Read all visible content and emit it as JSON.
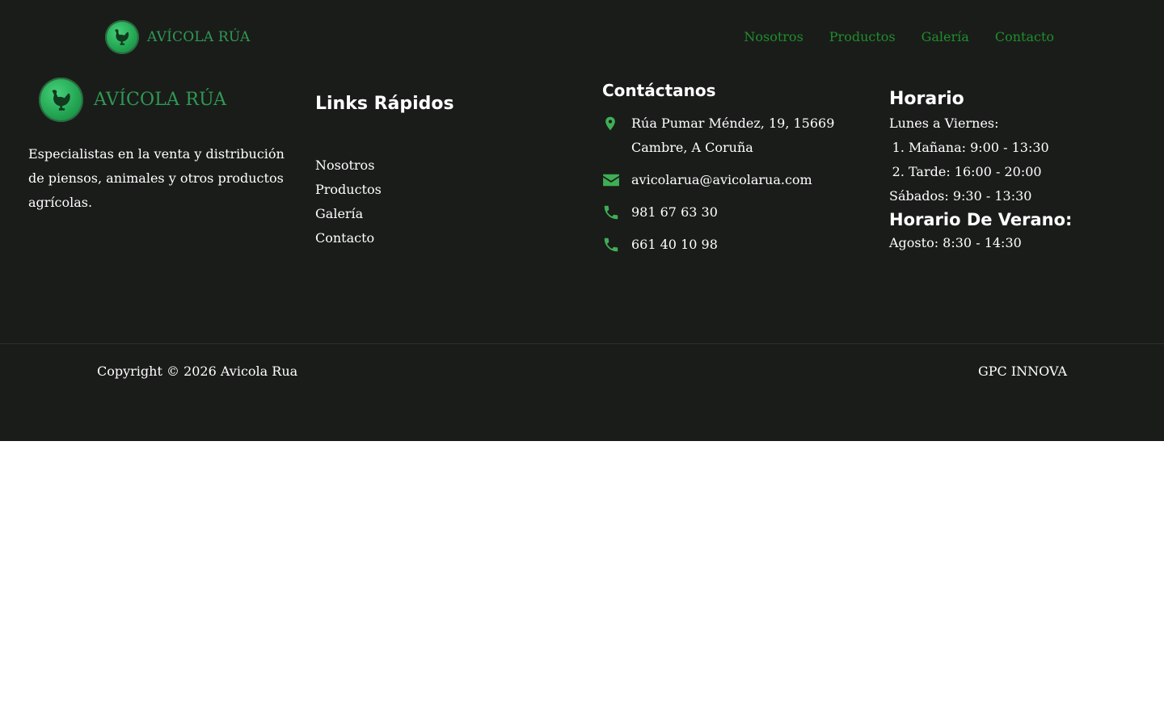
{
  "brand": {
    "name": "AVÍCOLA RÚA",
    "logo_icon": "hen-icon",
    "accent": "#2f9a52"
  },
  "nav": {
    "items": [
      "Nosotros",
      "Productos",
      "Galería",
      "Contacto"
    ],
    "color": "#1f8e2a"
  },
  "footer": {
    "about": "Especialistas en la venta y distribución de piensos, animales y otros productos agrícolas.",
    "links_title": "Links Rápidos",
    "links": [
      "Nosotros",
      "Productos",
      "Galería",
      "Contacto"
    ],
    "contact_title": "Contáctanos",
    "contact": {
      "address": "Rúa Pumar Méndez, 19, 15669 Cambre, A Coruña",
      "email": "avicolarua@avicolarua.com",
      "phone1": "981 67 63 30",
      "phone2": "661 40 10 98"
    },
    "hours_title": "Horario",
    "weekdays_label": "Lunes a Viernes:",
    "weekday_slots": [
      "Mañana: 9:00 - 13:30",
      "Tarde: 16:00 - 20:00"
    ],
    "saturday": "Sábados: 9:30 - 13:30",
    "summer_title": "Horario De Verano:",
    "summer": "Agosto: 8:30 - 14:30",
    "background": "#1a1c1a",
    "icon_color": "#3fae55"
  },
  "bottom": {
    "copyright": "Copyright © 2026 Avicola Rua",
    "credit": "GPC INNOVA"
  }
}
